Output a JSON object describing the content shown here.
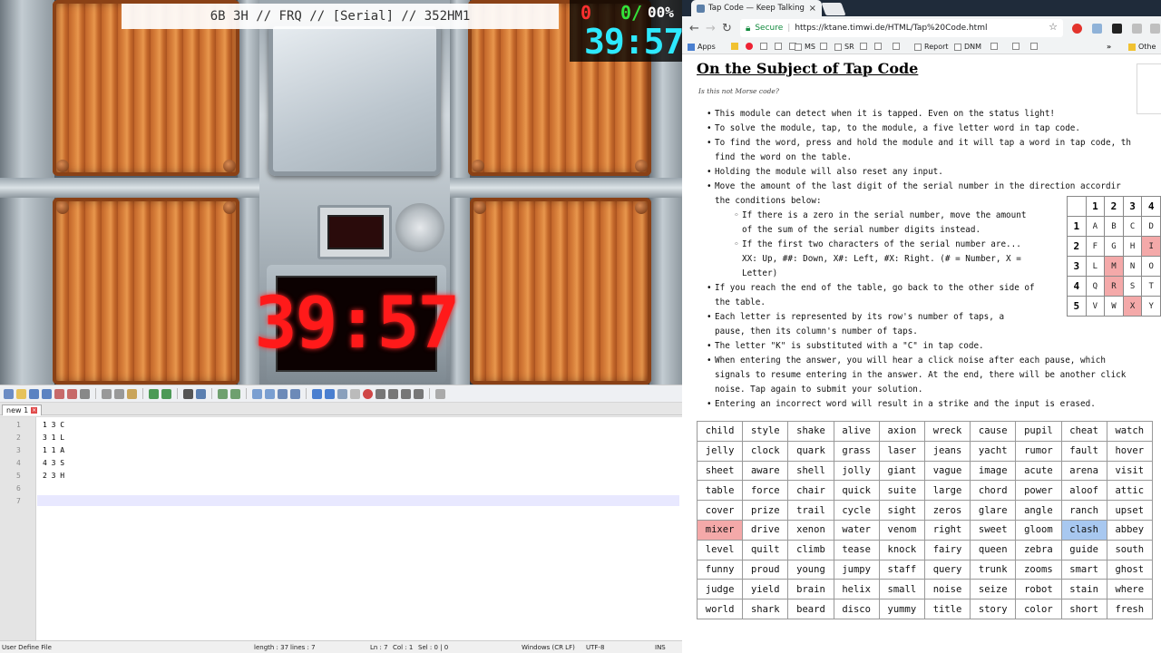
{
  "game": {
    "overlay_text": "6B 3H // FRQ // [Serial] // 352HM1",
    "hud": {
      "strikes": "0",
      "solved": "0/",
      "percent": "00%",
      "time": "39:57"
    },
    "bomb_timer": "39:57",
    "colors": {
      "panel_orange": "#d9813c",
      "timer_red": "#ff1a1a",
      "hud_cyan": "#2ee9ff"
    }
  },
  "notepad": {
    "tab_label": "new 1",
    "lines": [
      {
        "num": "1",
        "text": "1 3 C"
      },
      {
        "num": "2",
        "text": "3 1 L"
      },
      {
        "num": "3",
        "text": "1 1 A"
      },
      {
        "num": "4",
        "text": "4 3 S"
      },
      {
        "num": "5",
        "text": "2 3 H"
      },
      {
        "num": "6",
        "text": ""
      },
      {
        "num": "7",
        "text": ""
      }
    ],
    "status": {
      "language": "User Define File",
      "length": "length : 37",
      "lines": "lines : 7",
      "ln": "Ln : 7",
      "col": "Col : 1",
      "sel": "Sel : 0 | 0",
      "eol": "Windows (CR LF)",
      "encoding": "UTF-8",
      "mode": "INS"
    }
  },
  "browser": {
    "tab_title": "Tap Code — Keep Talking",
    "secure_label": "Secure",
    "url": "https://ktane.timwi.de/HTML/Tap%20Code.html",
    "bookmarks": [
      "Apps",
      "MS",
      "SR",
      "Report",
      "DNM",
      "Othe"
    ],
    "page": {
      "title": "On the Subject of Tap Code",
      "subtitle": "Is this not Morse code?",
      "rules": [
        "This module can detect when it is tapped. Even on the status light!",
        "To solve the module, tap, to the module, a five letter word in tap code.",
        "To find the word, press and hold the module and it will tap a word in tap code, th",
        "find the word on the table.",
        "Holding the module will also reset any input.",
        "Move the amount of the last digit of the serial number in the direction accordir",
        "the conditions below:",
        "If there is a zero in the serial number, move the amount",
        "of the sum of the serial number digits instead.",
        "If the first two characters of the serial number are...",
        "XX: Up, ##: Down, X#: Left, #X: Right. (# = Number, X =",
        "Letter)",
        "If you reach the end of the table, go back to the other side of",
        "the table.",
        "Each letter is represented by its row's number of taps, a",
        "pause, then its column's number of taps.",
        "The letter \"K\" is substituted with a \"C\" in tap code.",
        "When entering the answer, you will hear a click noise after each pause, which",
        "signals to resume entering in the answer. At the end, there will be another click",
        "noise. Tap again to submit your solution.",
        "Entering an incorrect word will result in a strike and the input is erased."
      ],
      "tap_grid": {
        "header": [
          "",
          "1",
          "2",
          "3",
          "4"
        ],
        "rows": [
          [
            "1",
            "A",
            "B",
            "C",
            "D"
          ],
          [
            "2",
            "F",
            "G",
            "H",
            "I"
          ],
          [
            "3",
            "L",
            "M",
            "N",
            "O"
          ],
          [
            "4",
            "Q",
            "R",
            "S",
            "T"
          ],
          [
            "5",
            "V",
            "W",
            "X",
            "Y"
          ]
        ]
      },
      "words": [
        [
          "child",
          "style",
          "shake",
          "alive",
          "axion",
          "wreck",
          "cause",
          "pupil",
          "cheat",
          "watch"
        ],
        [
          "jelly",
          "clock",
          "quark",
          "grass",
          "laser",
          "jeans",
          "yacht",
          "rumor",
          "fault",
          "hover"
        ],
        [
          "sheet",
          "aware",
          "shell",
          "jolly",
          "giant",
          "vague",
          "image",
          "acute",
          "arena",
          "visit"
        ],
        [
          "table",
          "force",
          "chair",
          "quick",
          "suite",
          "large",
          "chord",
          "power",
          "aloof",
          "attic"
        ],
        [
          "cover",
          "prize",
          "trail",
          "cycle",
          "sight",
          "zeros",
          "glare",
          "angle",
          "ranch",
          "upset"
        ],
        [
          "mixer",
          "drive",
          "xenon",
          "water",
          "venom",
          "right",
          "sweet",
          "gloom",
          "clash",
          "abbey"
        ],
        [
          "level",
          "quilt",
          "climb",
          "tease",
          "knock",
          "fairy",
          "queen",
          "zebra",
          "guide",
          "south"
        ],
        [
          "funny",
          "proud",
          "young",
          "jumpy",
          "staff",
          "query",
          "trunk",
          "zooms",
          "smart",
          "ghost"
        ],
        [
          "judge",
          "yield",
          "brain",
          "helix",
          "small",
          "noise",
          "seize",
          "robot",
          "stain",
          "where"
        ],
        [
          "world",
          "shark",
          "beard",
          "disco",
          "yummy",
          "title",
          "story",
          "color",
          "short",
          "fresh"
        ]
      ]
    }
  }
}
